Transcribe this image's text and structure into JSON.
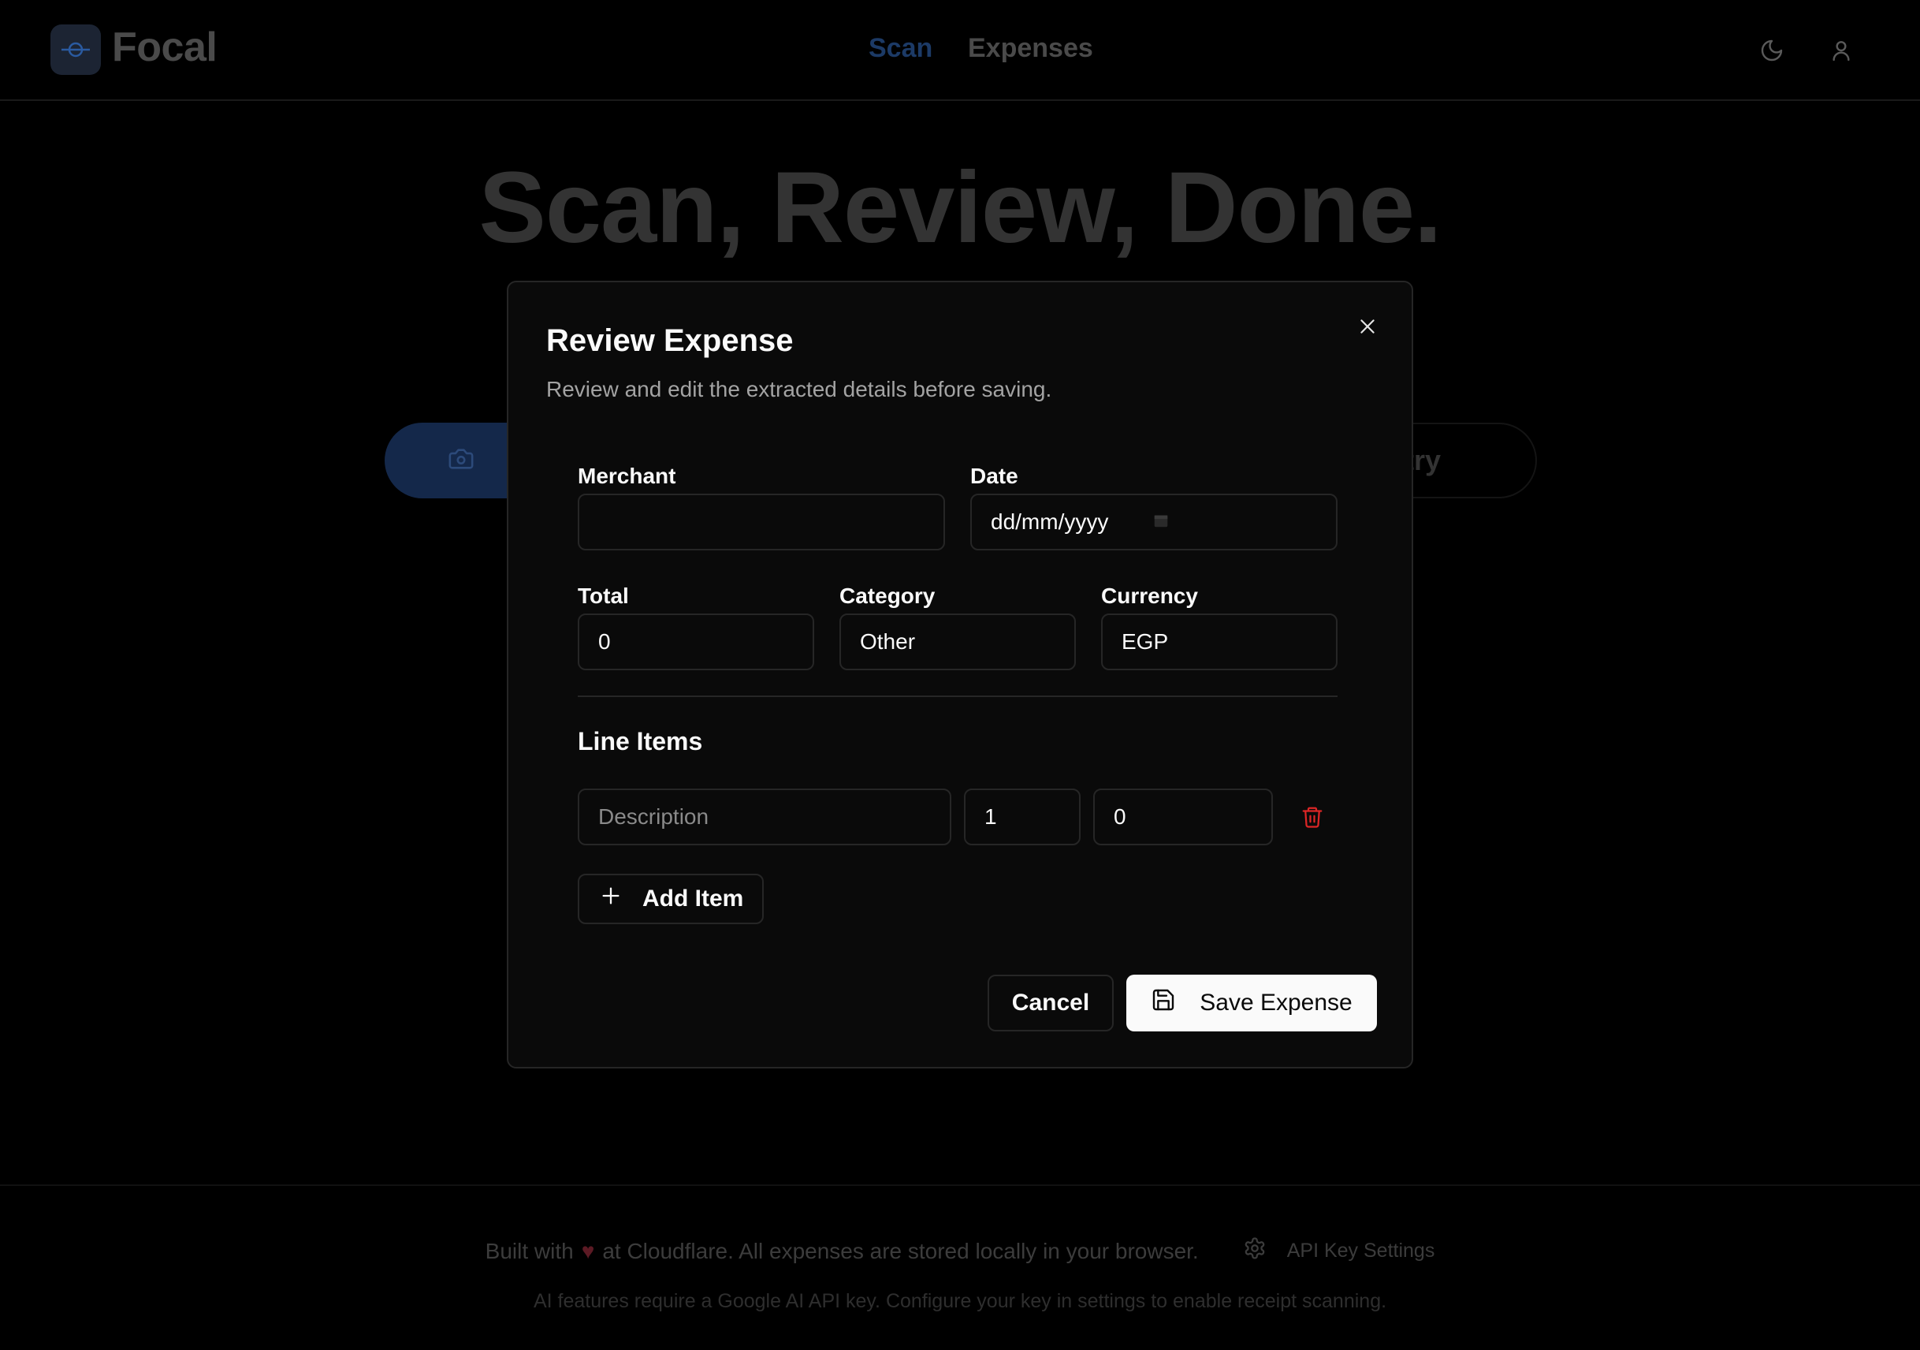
{
  "app": {
    "name": "Focal",
    "nav": [
      {
        "label": "Scan"
      },
      {
        "label": "Expenses"
      }
    ]
  },
  "hero": {
    "title": "Scan, Review, Done.",
    "entry_button_fragment": "ntry"
  },
  "modal": {
    "title": "Review Expense",
    "description": "Review and edit the extracted details before saving.",
    "fields": {
      "merchant": {
        "label": "Merchant",
        "value": ""
      },
      "date": {
        "label": "Date",
        "value": "dd/mm/yyyy"
      },
      "total": {
        "label": "Total",
        "value": "0"
      },
      "category": {
        "label": "Category",
        "value": "Other"
      },
      "currency": {
        "label": "Currency",
        "value": "EGP"
      }
    },
    "line_items_title": "Line Items",
    "line_items": [
      {
        "description": "",
        "description_placeholder": "Description",
        "quantity": "1",
        "price": "0"
      }
    ],
    "add_item_label": "Add Item",
    "cancel_label": "Cancel",
    "save_label": "Save Expense"
  },
  "footer": {
    "built_with_prefix": "Built with",
    "heart": "♥",
    "built_with_suffix": "at Cloudflare. All expenses are stored locally in your browser.",
    "settings_label": "API Key Settings",
    "note": "AI features require a Google AI API key. Configure your key in settings to enable receipt scanning."
  },
  "colors": {
    "accent": "#1c3a66",
    "danger": "#dc2626",
    "modal_bg": "#0a0a0a",
    "border": "#262626"
  },
  "icons": {
    "logo": "focus-icon",
    "theme": "moon-icon",
    "user": "user-icon",
    "camera": "camera-icon",
    "close": "close-icon",
    "calendar": "calendar-icon",
    "trash": "trash-icon",
    "add": "plus-icon",
    "save": "save-icon",
    "settings": "gear-icon"
  }
}
